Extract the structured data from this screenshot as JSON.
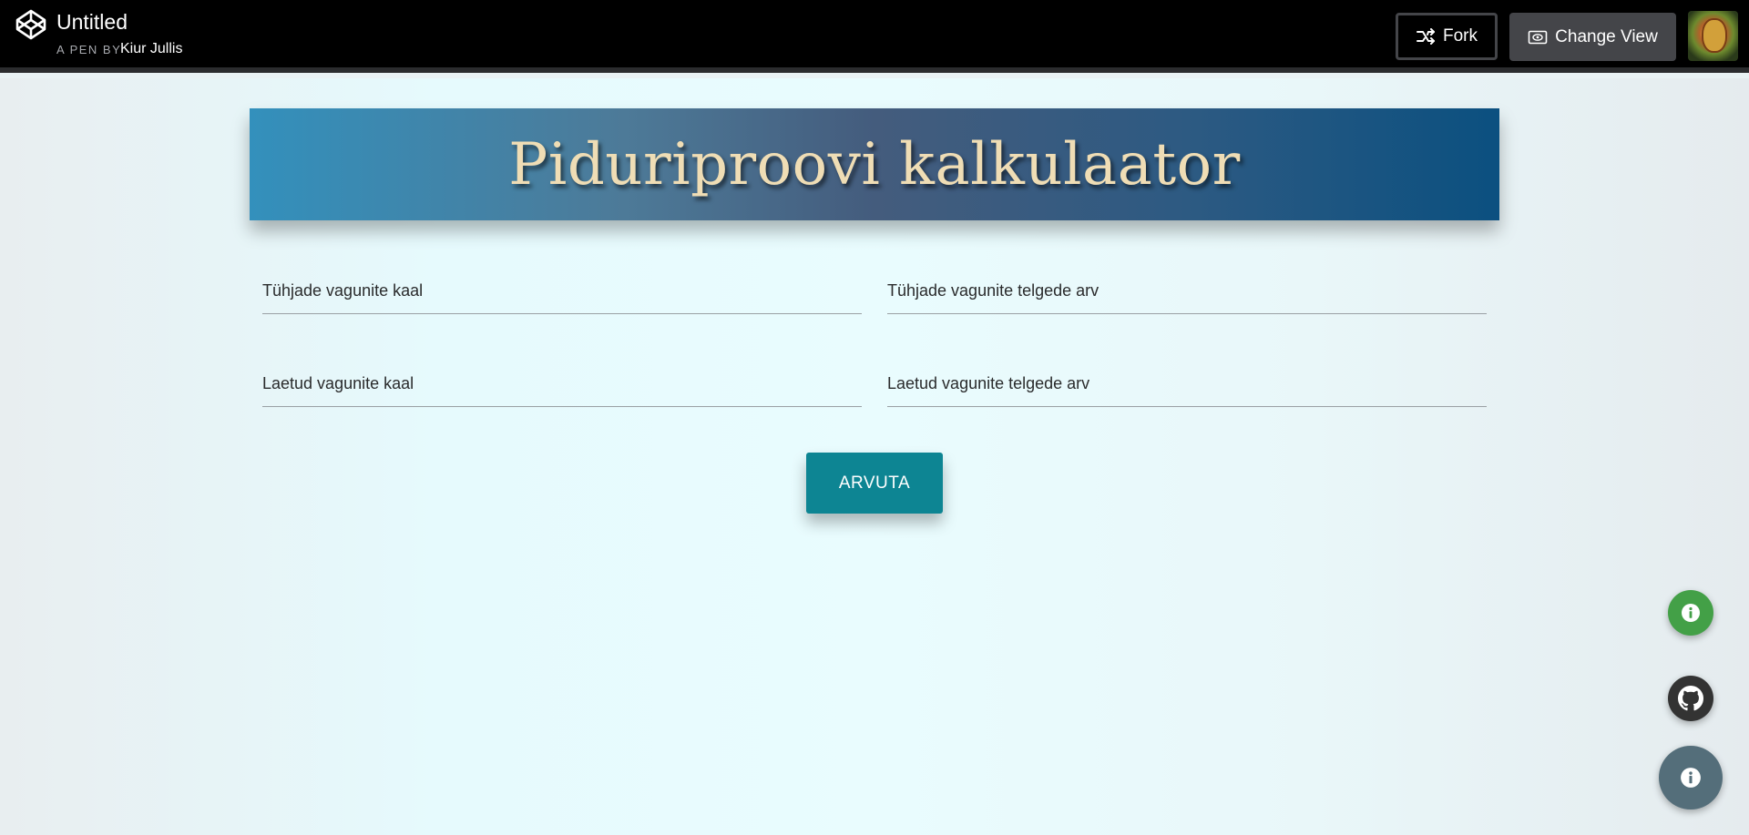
{
  "header": {
    "pen_title": "Untitled",
    "pen_by_label": "A PEN BY",
    "author": "Kiur Jullis",
    "fork_label": "Fork",
    "change_view_label": "Change View"
  },
  "banner": {
    "title": "Piduriproovi kalkulaator"
  },
  "form": {
    "fields": [
      {
        "label": "Tühjade vagunite kaal",
        "value": ""
      },
      {
        "label": "Tühjade vagunite telgede arv",
        "value": ""
      },
      {
        "label": "Laetud vagunite kaal",
        "value": ""
      },
      {
        "label": "Laetud vagunite telgede arv",
        "value": ""
      }
    ],
    "submit_label": "ARVUTA"
  },
  "fabs": {
    "info_color": "#43a047",
    "github_color": "#333333",
    "main_color": "#546e7a"
  },
  "colors": {
    "banner_title": "#efddb5",
    "button": "#0d8593"
  }
}
